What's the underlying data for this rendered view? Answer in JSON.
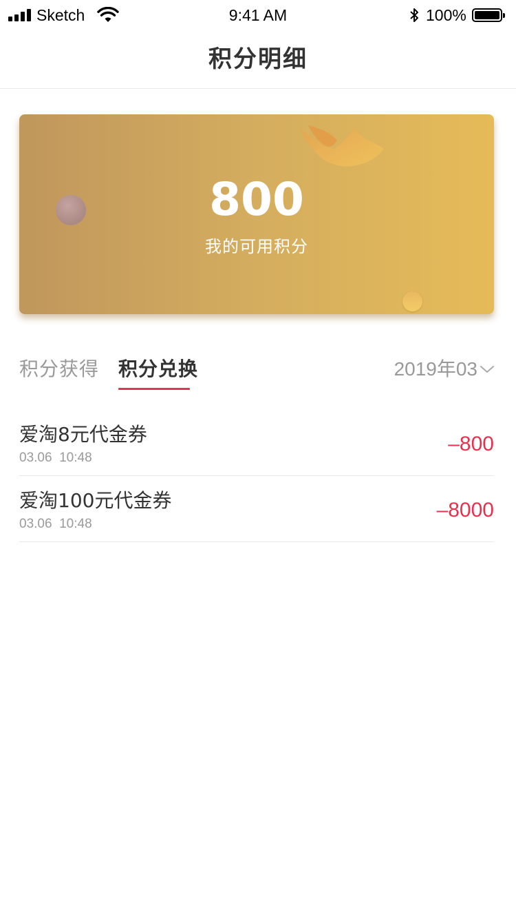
{
  "status_bar": {
    "carrier": "Sketch",
    "time": "9:41 AM",
    "battery": "100%",
    "icons": [
      "signal-icon",
      "wifi-icon",
      "bluetooth-icon",
      "battery-icon"
    ]
  },
  "header": {
    "title": "积分明细"
  },
  "points_card": {
    "value": "800",
    "label": "我的可用积分",
    "gradient_colors": [
      "#c0975c",
      "#e5bb58"
    ]
  },
  "tabs": [
    {
      "label": "积分获得",
      "active": false
    },
    {
      "label": "积分兑换",
      "active": true
    }
  ],
  "date_filter": {
    "value": "2019年03",
    "icon": "chevron-down-icon"
  },
  "records": [
    {
      "title": "爱淘8元代金券",
      "time": "03.06  10:48",
      "amount": "–800"
    },
    {
      "title": "爱淘100元代金券",
      "time": "03.06  10:48",
      "amount": "–8000"
    }
  ],
  "colors": {
    "accent": "#e8314d",
    "primary_text": "#333333",
    "secondary_text": "#999999"
  }
}
